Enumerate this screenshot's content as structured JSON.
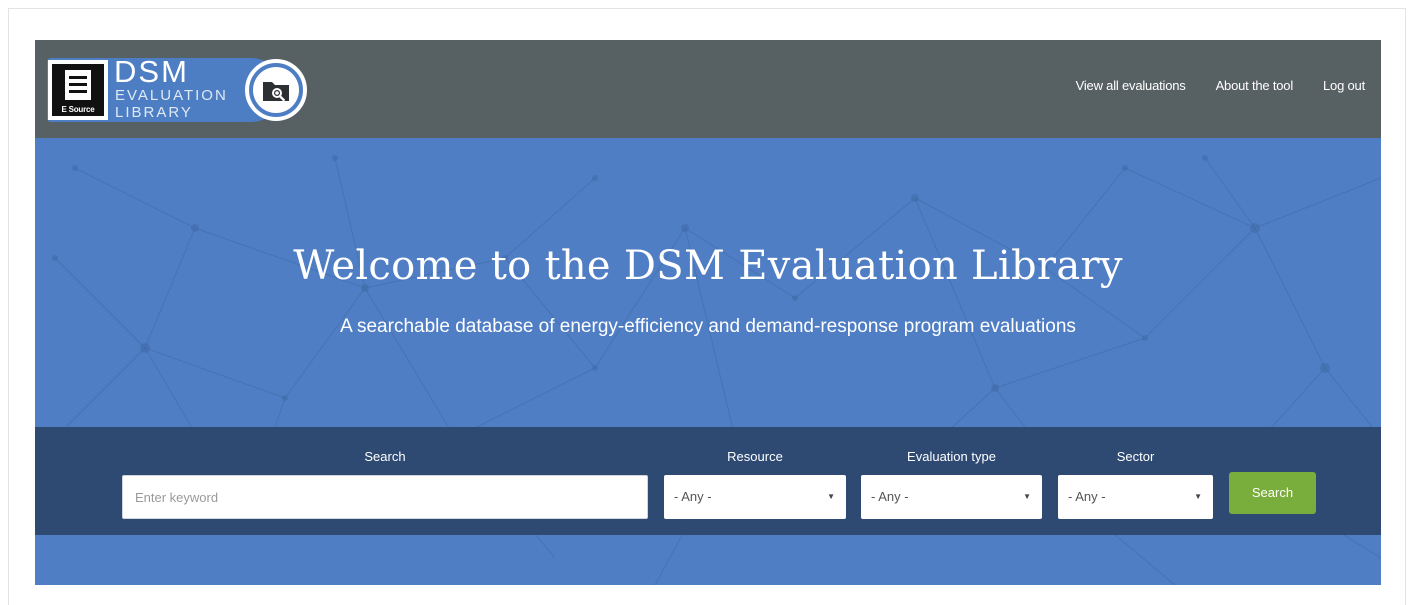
{
  "logo": {
    "brand": "E Source",
    "line1": "DSM",
    "line2": "EVALUATION",
    "line3": "LIBRARY"
  },
  "nav": {
    "items": [
      {
        "label": "View all evaluations"
      },
      {
        "label": "About the tool"
      },
      {
        "label": "Log out"
      }
    ]
  },
  "hero": {
    "title": "Welcome to the DSM Evaluation Library",
    "subtitle": "A searchable database of energy-efficiency and demand-response program evaluations"
  },
  "search": {
    "keyword_label": "Search",
    "keyword_placeholder": "Enter keyword",
    "keyword_value": "",
    "resource_label": "Resource",
    "resource_value": "- Any -",
    "evaltype_label": "Evaluation type",
    "evaltype_value": "- Any -",
    "sector_label": "Sector",
    "sector_value": "- Any -",
    "button_label": "Search"
  },
  "colors": {
    "header": "#576063",
    "hero": "#4f7ec4",
    "search_band": "#2e4a72",
    "button": "#79ad3c"
  }
}
